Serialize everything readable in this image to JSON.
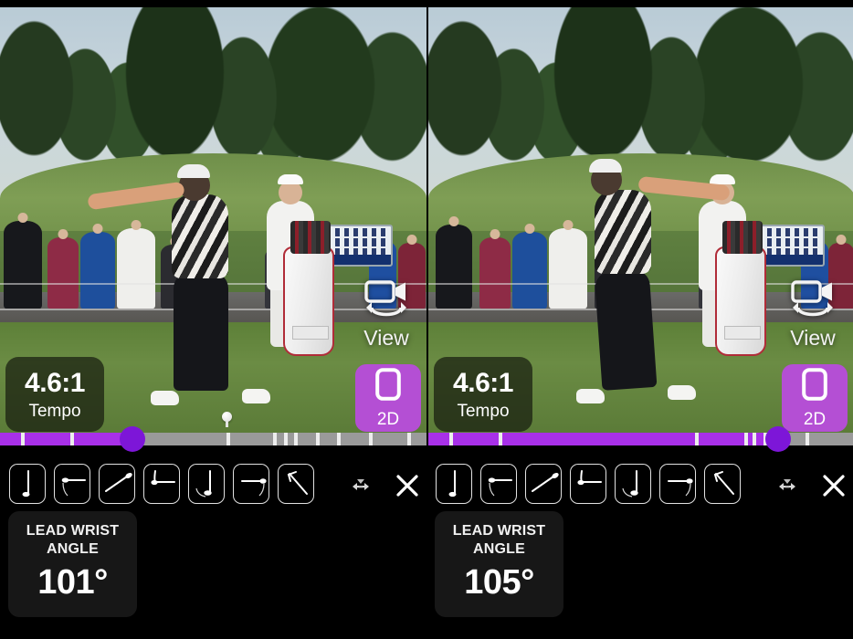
{
  "app": {
    "name": "golf-swing-analyzer",
    "accent_purple": "#b44fd4",
    "scrub_purple": "#a830e8",
    "thumb_purple": "#7d16d8"
  },
  "panels": [
    {
      "id": "left",
      "view_button": {
        "label": "View",
        "icon": "video-camera-rotate-icon"
      },
      "tempo_card": {
        "value": "4.6:1",
        "caption": "Tempo"
      },
      "mode_button": {
        "label": "2D",
        "icon": "phone-portrait-icon"
      },
      "scrubber": {
        "progress_percent": 31,
        "thumb_percent": 31,
        "ticks_percent": [
          5,
          16.5,
          53,
          64,
          66.5,
          69,
          74,
          79,
          86.5,
          95.5
        ]
      },
      "toolbar": {
        "positions": [
          {
            "name": "p1-address",
            "label": "P1"
          },
          {
            "name": "p2-takeaway",
            "label": "P2"
          },
          {
            "name": "p3-backswing",
            "label": "P3"
          },
          {
            "name": "p4-top",
            "label": "P4"
          },
          {
            "name": "p5-downswing",
            "label": "P5"
          },
          {
            "name": "p6-impact",
            "label": "P6"
          },
          {
            "name": "p7-follow-through",
            "label": "P7"
          }
        ],
        "resize_icon": "horizontal-resize-icon",
        "close_icon": "close-x-icon"
      },
      "metric": {
        "title": "LEAD WRIST ANGLE",
        "value": "101°"
      }
    },
    {
      "id": "right",
      "view_button": {
        "label": "View",
        "icon": "video-camera-rotate-icon"
      },
      "tempo_card": {
        "value": "4.6:1",
        "caption": "Tempo"
      },
      "mode_button": {
        "label": "2D",
        "icon": "phone-portrait-icon"
      },
      "scrubber": {
        "progress_percent": 82,
        "thumb_percent": 82,
        "ticks_percent": [
          5,
          16.5,
          62.5,
          74,
          76,
          78.5,
          88.5
        ]
      },
      "toolbar": {
        "positions": [
          {
            "name": "p1-address",
            "label": "P1"
          },
          {
            "name": "p2-takeaway",
            "label": "P2"
          },
          {
            "name": "p3-backswing",
            "label": "P3"
          },
          {
            "name": "p4-top",
            "label": "P4"
          },
          {
            "name": "p5-downswing",
            "label": "P5"
          },
          {
            "name": "p6-impact",
            "label": "P6"
          },
          {
            "name": "p7-follow-through",
            "label": "P7"
          }
        ],
        "resize_icon": "horizontal-resize-icon",
        "close_icon": "close-x-icon"
      },
      "metric": {
        "title": "LEAD WRIST ANGLE",
        "value": "105°"
      }
    }
  ]
}
